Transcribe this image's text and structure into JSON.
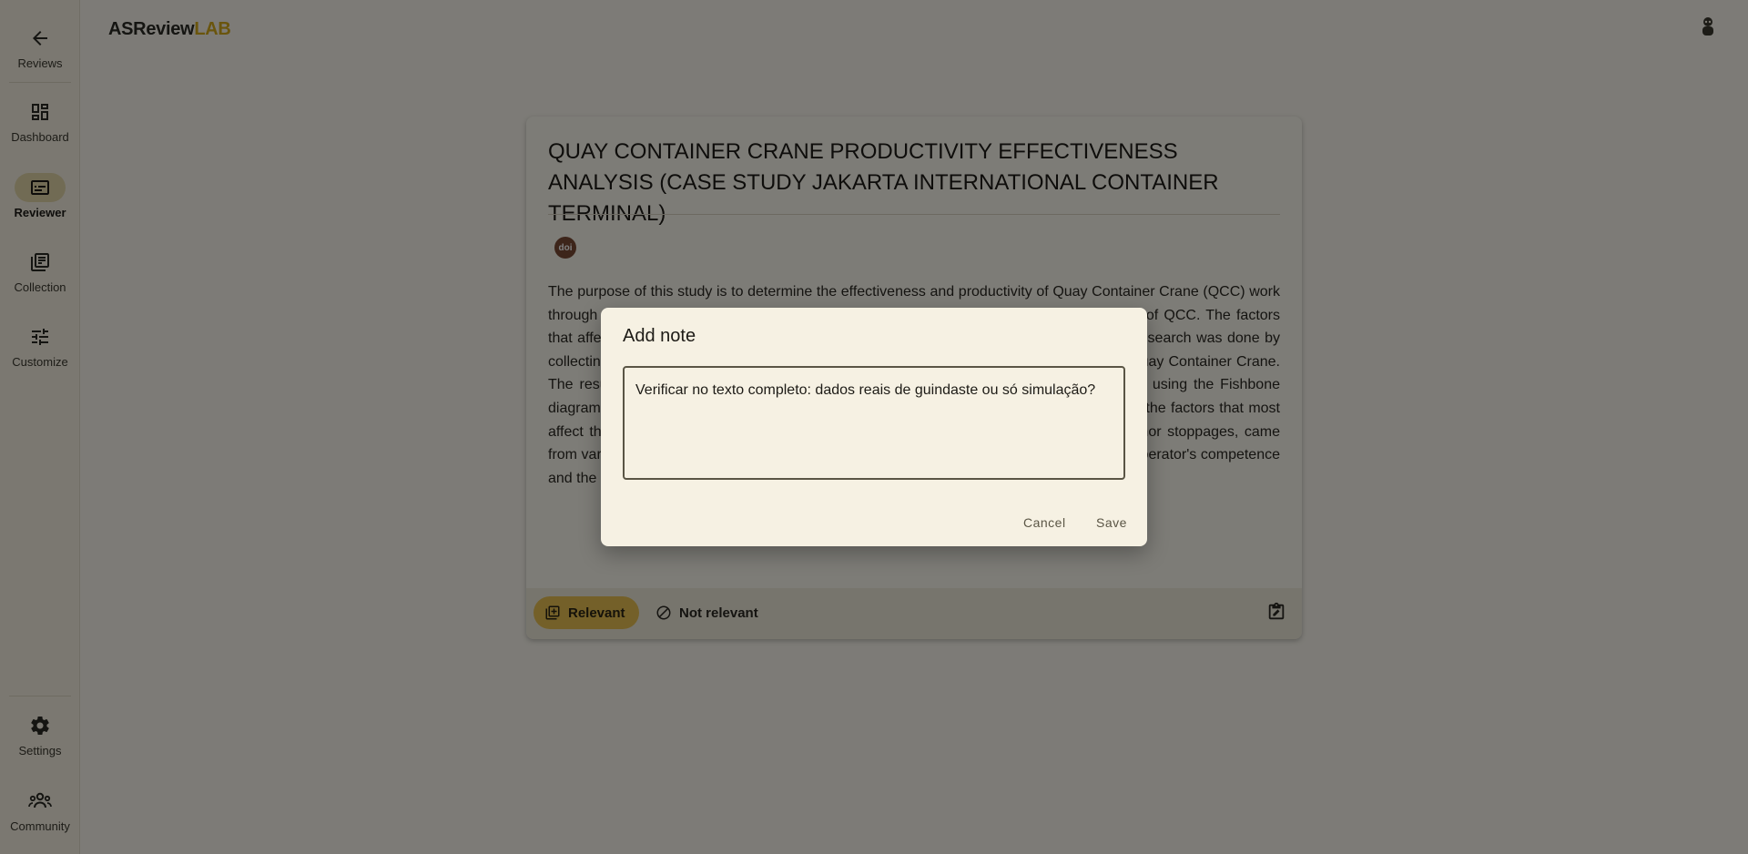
{
  "app": {
    "brand_primary": "ASReview",
    "brand_accent": "LAB",
    "accent_color": "#d5aa1a"
  },
  "sidebar": {
    "items": [
      {
        "label": "Reviews",
        "icon": "arrow-left-icon"
      },
      {
        "label": "Dashboard",
        "icon": "dashboard-icon"
      },
      {
        "label": "Reviewer",
        "icon": "reviewer-icon",
        "active": true
      },
      {
        "label": "Collection",
        "icon": "library-icon"
      },
      {
        "label": "Customize",
        "icon": "tune-icon"
      }
    ],
    "bottom_items": [
      {
        "label": "Settings",
        "icon": "gear-icon"
      },
      {
        "label": "Community",
        "icon": "community-icon"
      }
    ]
  },
  "record": {
    "title": "QUAY CONTAINER CRANE PRODUCTIVITY EFFECTIVENESS ANALYSIS (CASE STUDY JAKARTA INTERNATIONAL CONTAINER TERMINAL)",
    "doi_label": "doi",
    "abstract": "The purpose of this study is to determine the effectiveness and productivity of Quay Container Crane (QCC) work through the Overall Equipment Effectiveness (OEE) method by calculating the OEE value of QCC. The factors that affect the OEE value are availability, performance and quality of the equipment. This research was done by collecting, compiling, classifying and analysing the data of working time and downtime of Quay Container Crane. The results of the OEE calculation are then continued with the cause and effect analysis using the Fishbone diagram to find the root of the problem in the OEE method. Based on the research results, the factors that most affect the OEE value, which are reduce speed losses, breakdown losses and idling & minor stoppages, came from various causes, among others, the lack of maintenance activity of the equipment, the operator's competence and the lack of coordination in the operation of the cranes."
  },
  "actions": {
    "relevant_label": "Relevant",
    "not_relevant_label": "Not relevant"
  },
  "dialog": {
    "title": "Add note",
    "note_value": "Verificar no texto completo: dados reais de guindaste ou só simulação?",
    "cancel_label": "Cancel",
    "save_label": "Save"
  }
}
